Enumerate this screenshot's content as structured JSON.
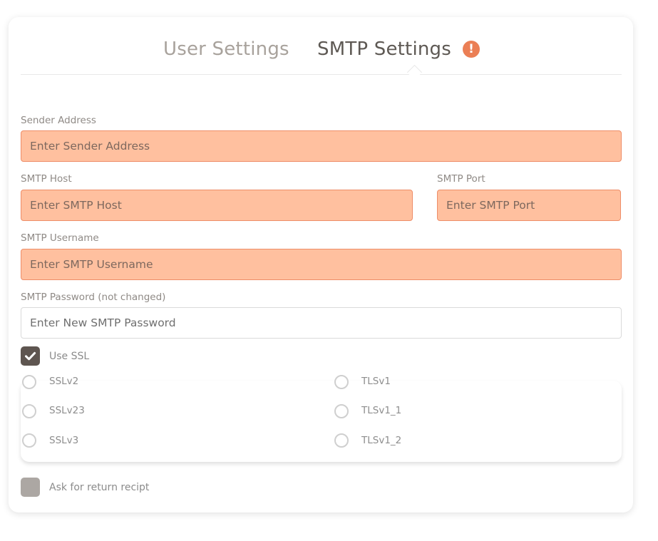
{
  "tabs": [
    {
      "label": "User Settings",
      "active": false
    },
    {
      "label": "SMTP Settings",
      "active": true,
      "alert_icon": "exclamation-icon",
      "alert_glyph": "!"
    }
  ],
  "form": {
    "sender_address": {
      "label": "Sender Address",
      "placeholder": "Enter Sender Address",
      "value": ""
    },
    "smtp_host": {
      "label": "SMTP Host",
      "placeholder": "Enter SMTP Host",
      "value": ""
    },
    "smtp_port": {
      "label": "SMTP Port",
      "placeholder": "Enter SMTP Port",
      "value": ""
    },
    "smtp_username": {
      "label": "SMTP Username",
      "placeholder": "Enter SMTP Username",
      "value": ""
    },
    "smtp_password": {
      "label": "SMTP Password (not changed)",
      "placeholder": "Enter New SMTP Password",
      "value": ""
    },
    "use_ssl": {
      "label": "Use SSL",
      "checked": true
    },
    "ssl_options": [
      {
        "label": "SSLv2",
        "selected": false
      },
      {
        "label": "SSLv23",
        "selected": false
      },
      {
        "label": "SSLv3",
        "selected": false
      },
      {
        "label": "TLSv1",
        "selected": false
      },
      {
        "label": "TLSv1_1",
        "selected": false
      },
      {
        "label": "TLSv1_2",
        "selected": false
      }
    ],
    "return_receipt": {
      "label": "Ask for return recipt",
      "checked": false
    }
  },
  "colors": {
    "invalid_field_bg": "#ffc09f",
    "invalid_field_border": "#ee8d68",
    "alert_badge": "#eb7f55",
    "checked_box": "#5e5550",
    "unchecked_box": "#aca7a3"
  }
}
